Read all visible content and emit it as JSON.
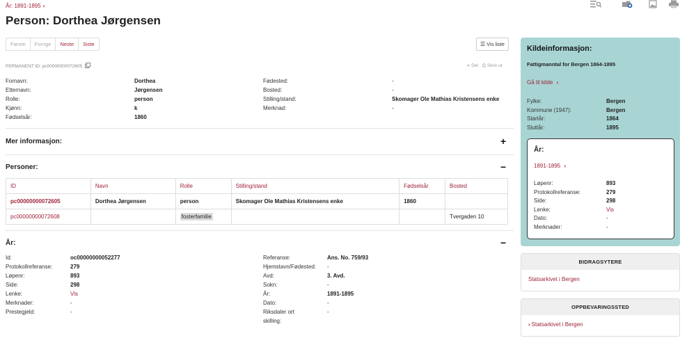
{
  "breadcrumb": {
    "text": "År: 1891-1895",
    "chevron": "›"
  },
  "toolbar": {
    "icons": [
      "search-list-icon",
      "add-folder-icon",
      "image-icon",
      "printer-icon"
    ]
  },
  "page_title": "Person: Dorthea Jørgensen",
  "pager": {
    "first": "Første",
    "prev": "Forrige",
    "next": "Neste",
    "last": "Siste"
  },
  "vis_liste": "Vis liste",
  "permanent_id": "PERMANENT ID: pc00000000072605",
  "actions": {
    "share": "Del",
    "print": "Skriv ut"
  },
  "person": {
    "left": [
      {
        "label": "Fornavn:",
        "value": "Dorthea"
      },
      {
        "label": "Etternavn:",
        "value": "Jørgensen"
      },
      {
        "label": "Rolle:",
        "value": "person"
      },
      {
        "label": "Kjønn:",
        "value": "k"
      },
      {
        "label": "Fødselsår:",
        "value": "1860"
      }
    ],
    "right": [
      {
        "label": "Fødested:",
        "value": "-"
      },
      {
        "label": "Bosted:",
        "value": "-"
      },
      {
        "label": "Stilling/stand:",
        "value": "Skomager Ole Mathias Kristensens enke"
      },
      {
        "label": "Merknad:",
        "value": "-"
      }
    ]
  },
  "mer_informasjon": {
    "title": "Mer informasjon:",
    "toggle": "+"
  },
  "personer": {
    "title": "Personer:",
    "toggle": "−",
    "headers": [
      "ID",
      "Navn",
      "Rolle",
      "Stilling/stand",
      "Fødselsår",
      "Bosted"
    ],
    "rows": [
      [
        "pc00000000072605",
        "Dorthea Jørgensen",
        "person",
        "Skomager Ole Mathias Kristensens enke",
        "1860",
        ""
      ],
      [
        "pc00000000072608",
        "",
        "fosterfamilie",
        "",
        "",
        "Tvergaden 10"
      ]
    ]
  },
  "aar": {
    "title": "År:",
    "toggle": "−",
    "left": [
      {
        "label": "Id:",
        "value": "oc00000000052277"
      },
      {
        "label": "Protokollreferanse:",
        "value": "279"
      },
      {
        "label": "Løpenr:",
        "value": "893"
      },
      {
        "label": "Side:",
        "value": "298"
      },
      {
        "label": "Lenke:",
        "value": "Vis"
      },
      {
        "label": "Merknader:",
        "value": "-"
      },
      {
        "label": "Prestegjeld:",
        "value": "-"
      }
    ],
    "right": [
      {
        "label": "Referanse:",
        "value": "Ans. No. 759/93"
      },
      {
        "label": "Hjemstavn/Fødested:",
        "value": "-"
      },
      {
        "label": "Avd:",
        "value": "3. Avd."
      },
      {
        "label": "Sokn:",
        "value": "-"
      },
      {
        "label": "År:",
        "value": "1891-1895"
      },
      {
        "label": "Dato:",
        "value": "-"
      },
      {
        "label": "Riksdaler ort",
        "value": "-"
      },
      {
        "label": "skilling:",
        "value": ""
      }
    ]
  },
  "sidebar": {
    "title": "Kildeinformasjon:",
    "source_name": "Fattigmanntal for Bergen 1864-1895",
    "goto": "Gå til kilde",
    "fields": [
      {
        "label": "Fylke:",
        "value": "Bergen"
      },
      {
        "label": "Kommune (1947):",
        "value": "Bergen"
      },
      {
        "label": "Startår:",
        "value": "1864"
      },
      {
        "label": "Sluttår:",
        "value": "1895"
      }
    ],
    "inner": {
      "title": "År:",
      "range": "1891-1895",
      "fields": [
        {
          "label": "Løpenr:",
          "value": "893"
        },
        {
          "label": "Protokollreferanse:",
          "value": "279"
        },
        {
          "label": "Side:",
          "value": "298"
        },
        {
          "label": "Lenke:",
          "value": "Vis"
        },
        {
          "label": "Dato:",
          "value": "-"
        },
        {
          "label": "Merknader:",
          "value": "-"
        }
      ]
    }
  },
  "bidragsytere": {
    "title": "BIDRAGSYTERE",
    "link": "Statsarkivet i Bergen"
  },
  "oppbevaringssted": {
    "title": "OPPBEVARINGSSTED",
    "link": "Statsarkivet i Bergen"
  },
  "colors": {
    "accent": "#a0233a",
    "sidebar_bg": "#a8d5d3"
  }
}
